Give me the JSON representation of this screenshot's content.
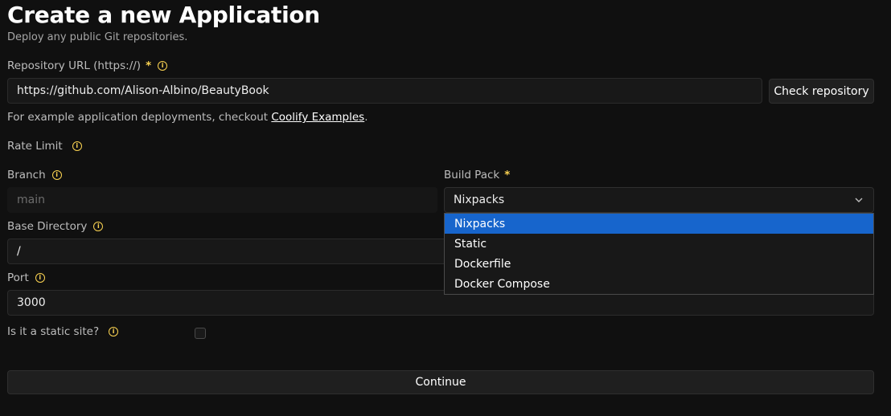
{
  "header": {
    "title": "Create a new Application",
    "subtitle": "Deploy any public Git repositories."
  },
  "repository": {
    "label": "Repository URL (https://)",
    "required_mark": "*",
    "value": "https://github.com/Alison-Albino/BeautyBook",
    "check_button": "Check repository",
    "helper_prefix": "For example application deployments, checkout",
    "helper_link": "Coolify Examples",
    "helper_suffix": "."
  },
  "rate_limit": {
    "label": "Rate Limit"
  },
  "branch": {
    "label": "Branch",
    "placeholder": "main"
  },
  "build_pack": {
    "label": "Build Pack",
    "required_mark": "*",
    "selected": "Nixpacks",
    "options": [
      "Nixpacks",
      "Static",
      "Dockerfile",
      "Docker Compose"
    ]
  },
  "base_directory": {
    "label": "Base Directory",
    "value": "/"
  },
  "port": {
    "label": "Port",
    "value": "3000"
  },
  "static_site": {
    "label": "Is it a static site?",
    "checked": false
  },
  "continue_button": "Continue",
  "icons": {
    "info": "info-circle-icon",
    "chevron": "chevron-down-icon"
  },
  "colors": {
    "background": "#101010",
    "accent": "#fcd452",
    "selected_option": "#1765cc"
  }
}
